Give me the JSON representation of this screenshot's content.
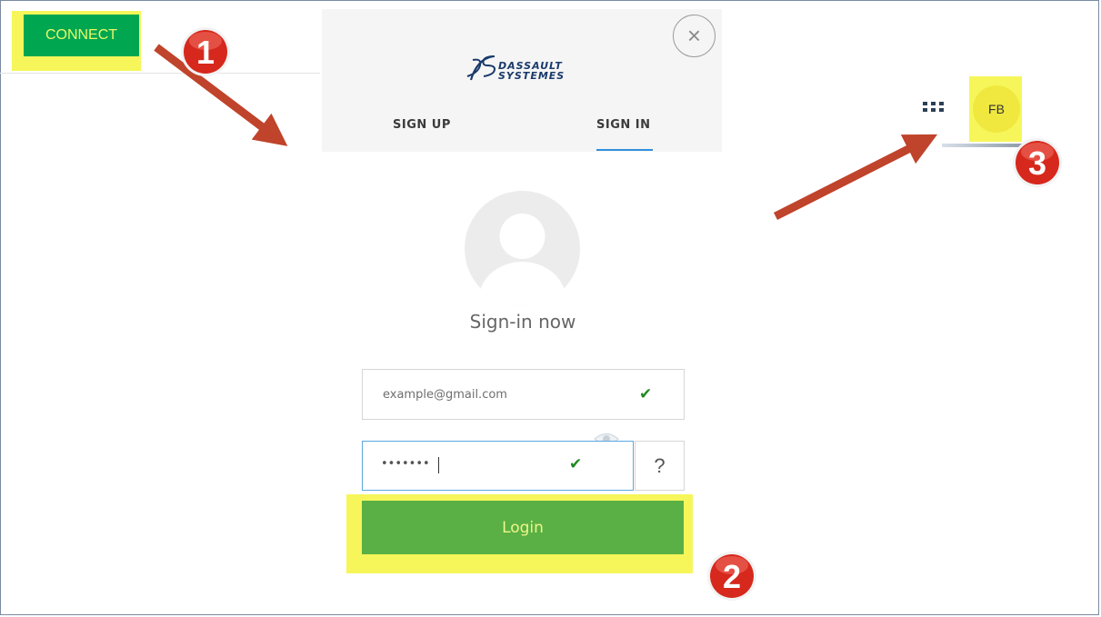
{
  "connect": {
    "label": "CONNECT"
  },
  "logo": {
    "line1": "DASSAULT",
    "line2": "SYSTEMES"
  },
  "tabs": [
    {
      "label": "SIGN UP"
    },
    {
      "label": "SIGN IN"
    }
  ],
  "signin": {
    "title": "Sign-in now",
    "email_value": "example@gmail.com",
    "password_value": "•••••••",
    "help_label": "?",
    "login_label": "Login"
  },
  "user": {
    "initials": "FB"
  },
  "annotations": {
    "step1": "1",
    "step2": "2",
    "step3": "3"
  },
  "colors": {
    "highlight": "#f6f65a",
    "connect_green": "#00a650",
    "login_green": "#5ab044",
    "arrow": "#c0432b",
    "badge_red": "#d6281c",
    "tab_accent": "#2f8fdc"
  }
}
